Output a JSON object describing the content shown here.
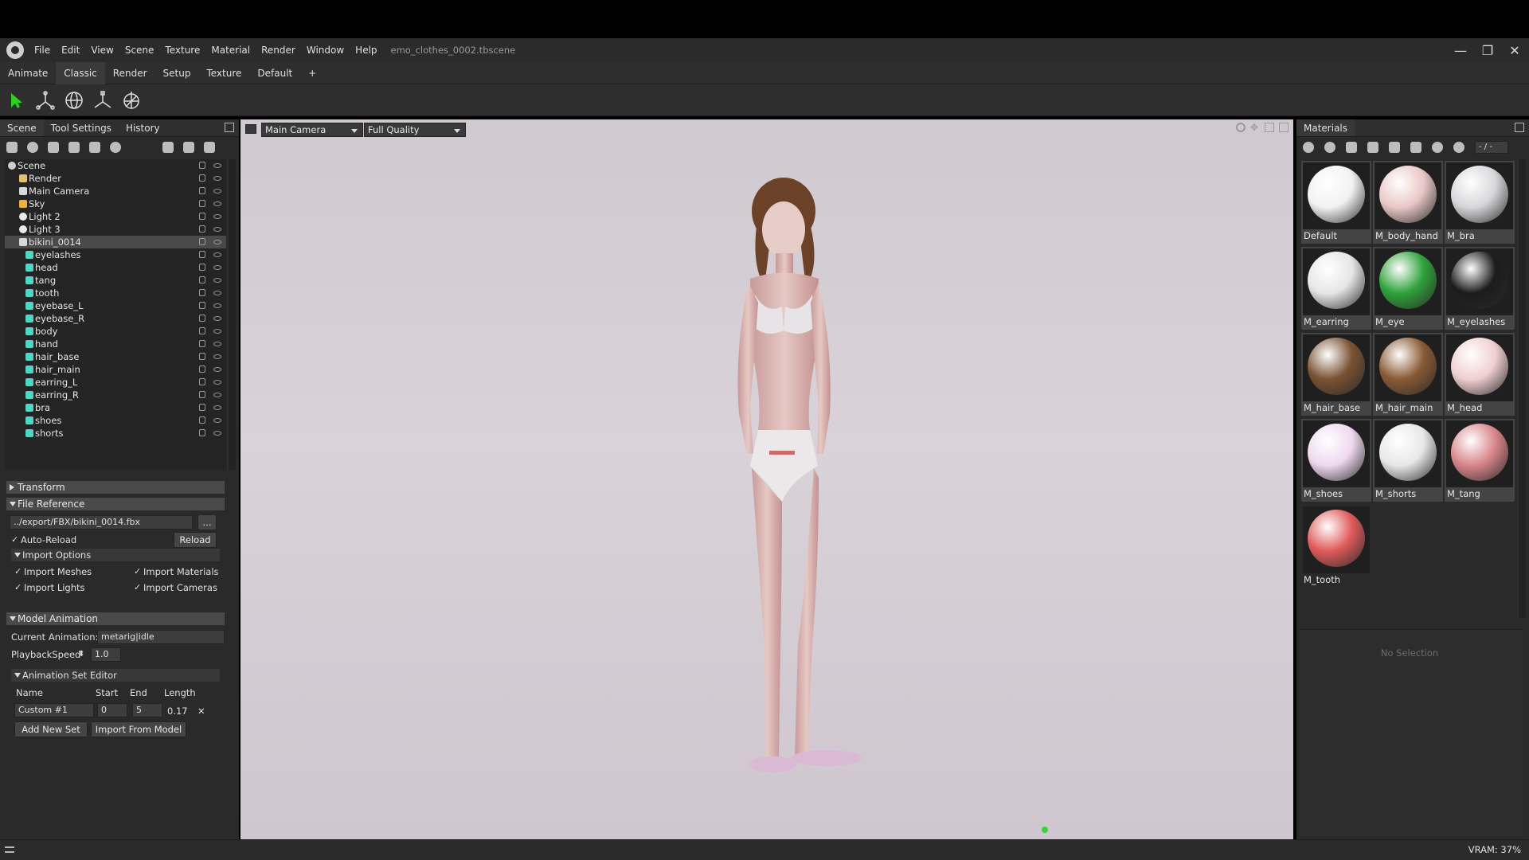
{
  "app": {
    "doc_title": "emo_clothes_0002.tbscene"
  },
  "menu": [
    "File",
    "Edit",
    "View",
    "Scene",
    "Texture",
    "Material",
    "Render",
    "Window",
    "Help"
  ],
  "window_controls": {
    "minimize": "—",
    "restore": "❐",
    "close": "✕"
  },
  "workspace_tabs": [
    "Animate",
    "Classic",
    "Render",
    "Setup",
    "Texture",
    "Default",
    "+"
  ],
  "active_workspace": "Classic",
  "toolbar_icons": [
    "select-arrow-icon",
    "move-gizmo-icon",
    "rotate-gizmo-icon",
    "scale-gizmo-icon",
    "transform-gizmo-icon"
  ],
  "left_panel": {
    "tabs": [
      "Scene",
      "Tool Settings",
      "History"
    ],
    "icons": [
      "mesh-icon",
      "light-icon",
      "camera-icon",
      "layers-icon",
      "object-icon",
      "globe-icon",
      "folder-icon",
      "duplicate-icon",
      "delete-icon"
    ],
    "tree": [
      {
        "label": "Scene",
        "level": 0,
        "type": "scene"
      },
      {
        "label": "Render",
        "level": 1,
        "type": "render"
      },
      {
        "label": "Main Camera",
        "level": 1,
        "type": "camera"
      },
      {
        "label": "Sky",
        "level": 1,
        "type": "sky"
      },
      {
        "label": "Light 2",
        "level": 1,
        "type": "light"
      },
      {
        "label": "Light 3",
        "level": 1,
        "type": "light"
      },
      {
        "label": "bikini_0014",
        "level": 1,
        "type": "model",
        "selected": true
      },
      {
        "label": "eyelashes",
        "level": 2,
        "type": "mesh"
      },
      {
        "label": "head",
        "level": 2,
        "type": "mesh"
      },
      {
        "label": "tang",
        "level": 2,
        "type": "mesh"
      },
      {
        "label": "tooth",
        "level": 2,
        "type": "mesh"
      },
      {
        "label": "eyebase_L",
        "level": 2,
        "type": "mesh"
      },
      {
        "label": "eyebase_R",
        "level": 2,
        "type": "mesh"
      },
      {
        "label": "body",
        "level": 2,
        "type": "mesh"
      },
      {
        "label": "hand",
        "level": 2,
        "type": "mesh"
      },
      {
        "label": "hair_base",
        "level": 2,
        "type": "mesh"
      },
      {
        "label": "hair_main",
        "level": 2,
        "type": "mesh"
      },
      {
        "label": "earring_L",
        "level": 2,
        "type": "mesh"
      },
      {
        "label": "earring_R",
        "level": 2,
        "type": "mesh"
      },
      {
        "label": "bra",
        "level": 2,
        "type": "mesh"
      },
      {
        "label": "shoes",
        "level": 2,
        "type": "mesh"
      },
      {
        "label": "shorts",
        "level": 2,
        "type": "mesh"
      }
    ],
    "transform_label": "Transform",
    "file_reference": {
      "label": "File Reference",
      "path": "../export/FBX/bikini_0014.fbx",
      "browse": "...",
      "auto_reload": "Auto-Reload",
      "reload": "Reload",
      "import_options": "Import Options",
      "import_meshes": "Import Meshes",
      "import_materials": "Import Materials",
      "import_lights": "Import Lights",
      "import_cameras": "Import Cameras"
    },
    "model_animation": {
      "label": "Model Animation",
      "current_animation_label": "Current Animation:",
      "current_animation": "metarig|idle",
      "playback_label": "PlaybackSpeed",
      "playback_value": "1.0",
      "set_editor": "Animation Set Editor",
      "col_name": "Name",
      "col_start": "Start",
      "col_end": "End",
      "col_length": "Length",
      "row": {
        "name": "Custom #1",
        "start": "0",
        "end": "5",
        "length": "0.17"
      },
      "remove": "✕",
      "add_new_set": "Add New Set",
      "import_from_model": "Import From Model"
    }
  },
  "viewport": {
    "camera": "Main Camera",
    "quality": "Full Quality"
  },
  "materials": {
    "title": "Materials",
    "counter": "- / -",
    "items": [
      {
        "name": "Default",
        "color": "#f2f2f2"
      },
      {
        "name": "M_body_hand",
        "color": "#e9c8c6"
      },
      {
        "name": "M_bra",
        "color": "#d7d7da"
      },
      {
        "name": "M_earring",
        "color": "#e6e6e6"
      },
      {
        "name": "M_eye",
        "color": "#2fa23a"
      },
      {
        "name": "M_eyelashes",
        "color": "#1c1c1c"
      },
      {
        "name": "M_hair_base",
        "color": "#7a5232"
      },
      {
        "name": "M_hair_main",
        "color": "#8a5a34"
      },
      {
        "name": "M_head",
        "color": "#f0cfcf"
      },
      {
        "name": "M_shoes",
        "color": "#efd9ef"
      },
      {
        "name": "M_shorts",
        "color": "#e8e8e8"
      },
      {
        "name": "M_tang",
        "color": "#d8868c"
      },
      {
        "name": "M_tooth",
        "color": "#e05a5a"
      }
    ],
    "no_selection": "No Selection"
  },
  "status": {
    "vram": "VRAM: 37%"
  }
}
